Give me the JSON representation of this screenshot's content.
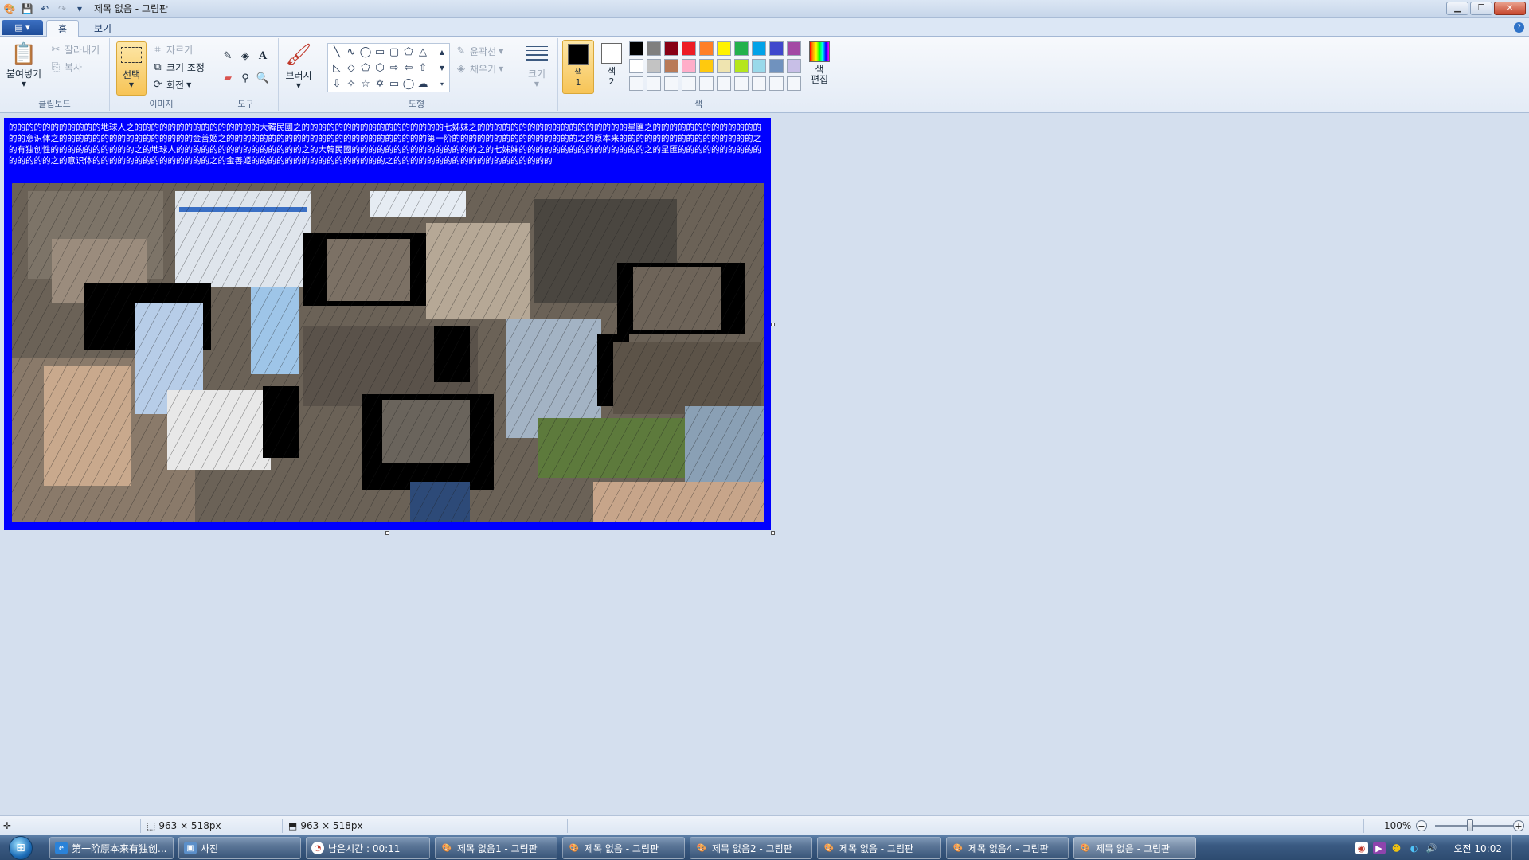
{
  "window": {
    "title": "제목 없음 - 그림판",
    "app_menu_label": "▤ ▾"
  },
  "tabs": [
    {
      "label": "홈"
    },
    {
      "label": "보기"
    }
  ],
  "clipboard": {
    "paste_label": "붙여넣기",
    "cut_label": "잘라내기",
    "copy_label": "복사",
    "group_label": "클립보드"
  },
  "image": {
    "select_label": "선택",
    "crop_label": "자르기",
    "resize_label": "크기 조정",
    "rotate_label": "회전",
    "group_label": "이미지"
  },
  "tools": {
    "group_label": "도구"
  },
  "brushes": {
    "label": "브러시"
  },
  "shapes": {
    "outline_label": "윤곽선",
    "fill_label": "채우기",
    "group_label": "도형"
  },
  "size": {
    "label": "크기"
  },
  "colors": {
    "color1_label": "색\n1",
    "color2_label": "색\n2",
    "edit_label": "색\n편집",
    "group_label": "색",
    "color1": "#000000",
    "color2": "#ffffff",
    "palette_row1": [
      "#000000",
      "#7f7f7f",
      "#880015",
      "#ed1c24",
      "#ff7f27",
      "#fff200",
      "#22b14c",
      "#00a2e8",
      "#3f48cc",
      "#a349a4"
    ],
    "palette_row2": [
      "#ffffff",
      "#c3c3c3",
      "#b97a57",
      "#ffaec9",
      "#ffc90e",
      "#efe4b0",
      "#b5e61d",
      "#99d9ea",
      "#7092be",
      "#c8bfe7"
    ]
  },
  "canvas": {
    "background": "#0000ff",
    "text": "的的的的的的的的的的的地球人之的的的的的的的的的的的的的的的大韓民國之的的的的的的的的的的的的的的的的的七姊妹之的的的的的的的的的的的的的的的的的的星匯之的的的的的的的的的的的的的的的意识体之的的的的的的的的的的的的的的的的金善姬之的的的的的的的的的的的的的的的的的的的的的的的的第一阶的的的的的的的的的的的的的的的之的原本来的的的的的的的的的的的的的的的的之的有独创性的的的的的的的的的的之的地球人的的的的的的的的的的的的的的的之的大韓民國的的的的的的的的的的的的的的的之的七姊妹的的的的的的的的的的的的的的的之的星匯的的的的的的的的的的的的的的的之的意识体的的的的的的的的的的的的的的之的金善姬的的的的的的的的的的的的的的的的之的的的的的的的的的的的的的的的的的的的"
  },
  "status": {
    "selection_size": "963 × 518px",
    "image_size": "963 × 518px",
    "zoom": "100%"
  },
  "taskbar": {
    "items": [
      {
        "label": "第一阶原本来有独创..."
      },
      {
        "label": "사진"
      },
      {
        "label": "남은시간 : 00:11"
      },
      {
        "label": "제목 없음1 - 그림판"
      },
      {
        "label": "제목 없음 - 그림판"
      },
      {
        "label": "제목 없음2 - 그림판"
      },
      {
        "label": "제목 없음 - 그림판"
      },
      {
        "label": "제목 없음4 - 그림판"
      },
      {
        "label": "제목 없음 - 그림판"
      }
    ],
    "clock": "오전 10:02"
  }
}
